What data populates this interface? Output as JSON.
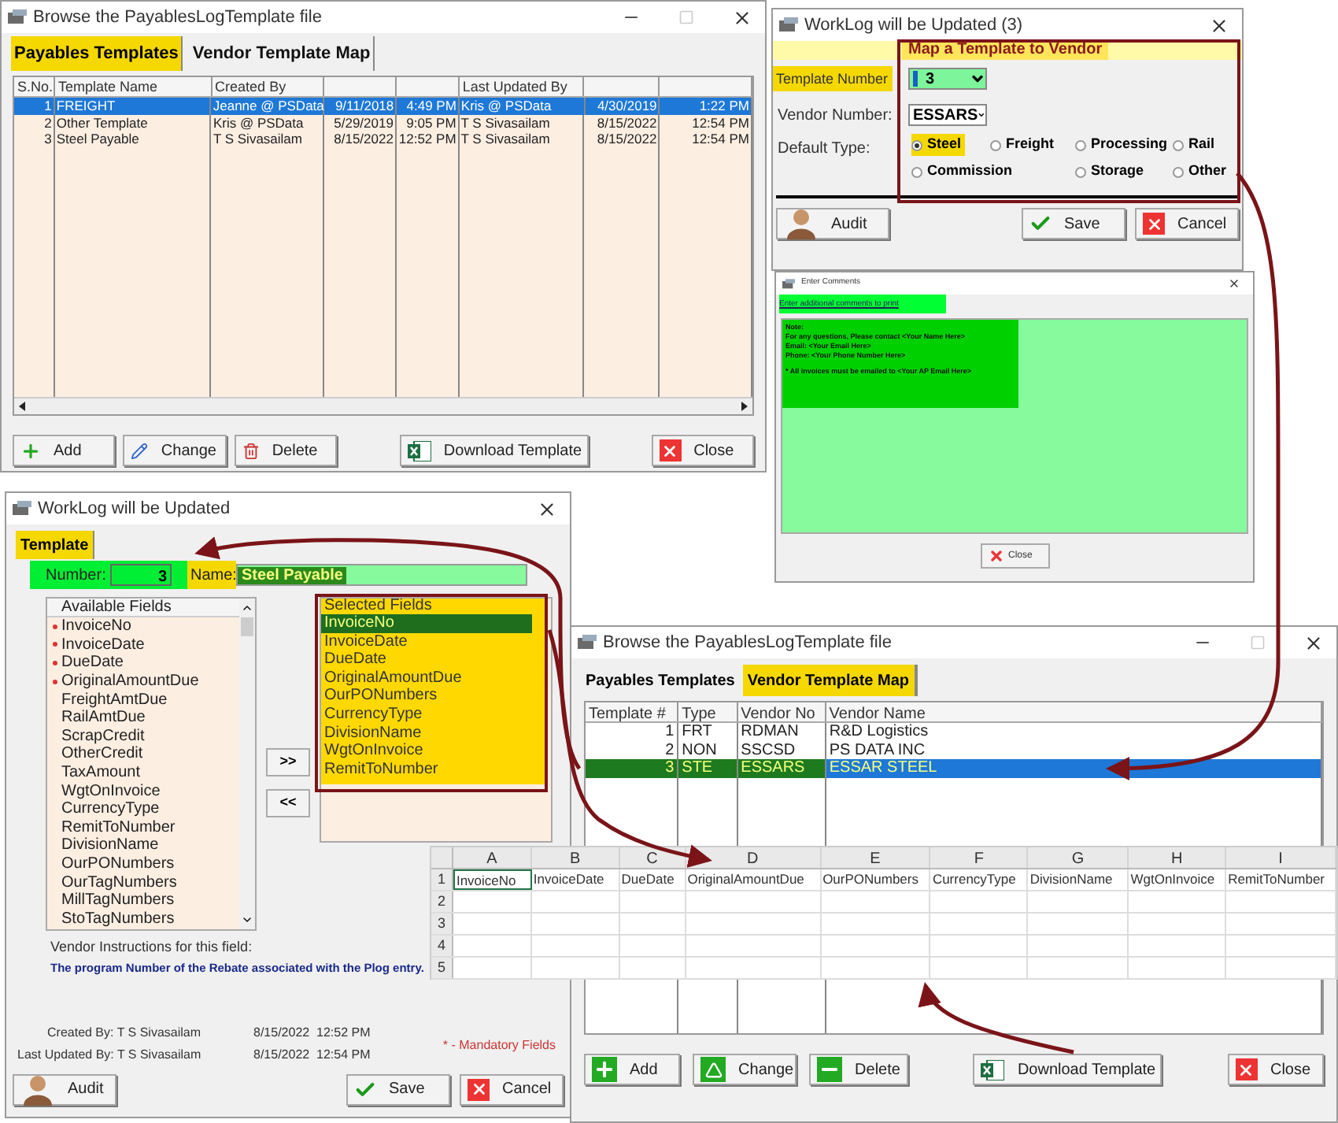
{
  "browse_templates_window": {
    "title": "Browse the PayablesLogTemplate file",
    "tabs": [
      {
        "label": "Payables Templates",
        "selected": true
      },
      {
        "label": "Vendor Template Map",
        "selected": false
      }
    ],
    "columns": [
      "S.No.",
      "Template Name",
      "Created By",
      "",
      "",
      "Last Updated By",
      "",
      ""
    ],
    "rows": [
      {
        "cells": [
          "1",
          "FREIGHT",
          "Jeanne @ PSData",
          "9/11/2018",
          "4:49 PM",
          "Kris @ PSData",
          "4/30/2019",
          "1:22 PM"
        ],
        "selected": true
      },
      {
        "cells": [
          "2",
          "Other Template",
          "Kris @ PSData",
          "5/29/2019",
          "9:05 PM",
          "T S Sivasailam",
          "8/15/2022",
          "12:54 PM"
        ],
        "selected": false
      },
      {
        "cells": [
          "3",
          "Steel Payable",
          "T S Sivasailam",
          "8/15/2022",
          "12:52 PM",
          "T S Sivasailam",
          "8/15/2022",
          "12:54 PM"
        ],
        "selected": false
      }
    ],
    "buttons": [
      {
        "label": "Add",
        "kind": "add"
      },
      {
        "label": "Change",
        "kind": "change"
      },
      {
        "label": "Delete",
        "kind": "delete"
      },
      {
        "label": "Download Template",
        "kind": "download"
      },
      {
        "label": "Close",
        "kind": "close"
      }
    ]
  },
  "map_vendor_window": {
    "title": "WorkLog will be Updated  (3)",
    "heading": "Map a Template to Vendor",
    "template_number": {
      "label": "Template Number",
      "value": "3"
    },
    "vendor_number": {
      "label": "Vendor Number:",
      "value": "ESSARS"
    },
    "default_type": {
      "label": "Default Type:",
      "options": [
        {
          "label": "Steel",
          "selected": true
        },
        {
          "label": "Freight",
          "selected": false
        },
        {
          "label": "Processing",
          "selected": false
        },
        {
          "label": "Rail",
          "selected": false
        },
        {
          "label": "Commission",
          "selected": false
        },
        {
          "label": "Storage",
          "selected": false
        },
        {
          "label": "Other",
          "selected": false
        }
      ]
    },
    "buttons": [
      {
        "label": "Audit",
        "kind": "audit"
      },
      {
        "label": "Save",
        "kind": "save"
      },
      {
        "label": "Cancel",
        "kind": "cancel"
      }
    ]
  },
  "comments_window": {
    "title": "Enter Comments",
    "link": "Enter additional comments to print",
    "paragraphs": [
      [
        "Note:",
        "For any questions, Please contact <Your Name Here>",
        "Email: <Your Email Here>",
        "Phone: <Your Phone Number Here>"
      ],
      [
        "* All invoices must be emailed to <Your AP Email Here>"
      ]
    ],
    "button": "Close"
  },
  "template_window": {
    "title": "WorkLog will be Updated",
    "tabs": [
      {
        "label": "Template",
        "selected": true
      }
    ],
    "number": {
      "label": "Number:",
      "value": "3"
    },
    "name": {
      "label": "Name:",
      "value": "Steel Payable"
    },
    "available_fields": {
      "header": "Available Fields",
      "items": [
        {
          "label": "InvoiceNo",
          "mandatory": true
        },
        {
          "label": "InvoiceDate",
          "mandatory": true
        },
        {
          "label": "DueDate",
          "mandatory": true
        },
        {
          "label": "OriginalAmountDue",
          "mandatory": true
        },
        {
          "label": "FreightAmtDue",
          "mandatory": false
        },
        {
          "label": "RailAmtDue",
          "mandatory": false
        },
        {
          "label": "ScrapCredit",
          "mandatory": false
        },
        {
          "label": "OtherCredit",
          "mandatory": false
        },
        {
          "label": "TaxAmount",
          "mandatory": false
        },
        {
          "label": "WgtOnInvoice",
          "mandatory": false
        },
        {
          "label": "CurrencyType",
          "mandatory": false
        },
        {
          "label": "RemitToNumber",
          "mandatory": false
        },
        {
          "label": "DivisionName",
          "mandatory": false
        },
        {
          "label": "OurPONumbers",
          "mandatory": false
        },
        {
          "label": "OurTagNumbers",
          "mandatory": false
        },
        {
          "label": "MillTagNumbers",
          "mandatory": false
        },
        {
          "label": "StoTagNumbers",
          "mandatory": false
        }
      ]
    },
    "move_buttons": [
      ">>",
      "<<"
    ],
    "selected_fields": {
      "header": "Selected Fields",
      "items": [
        {
          "label": "InvoiceNo",
          "selected": true
        },
        {
          "label": "InvoiceDate",
          "selected": false
        },
        {
          "label": "DueDate",
          "selected": false
        },
        {
          "label": "OriginalAmountDue",
          "selected": false
        },
        {
          "label": "OurPONumbers",
          "selected": false
        },
        {
          "label": "CurrencyType",
          "selected": false
        },
        {
          "label": "DivisionName",
          "selected": false
        },
        {
          "label": "WgtOnInvoice",
          "selected": false
        },
        {
          "label": "RemitToNumber",
          "selected": false
        }
      ]
    },
    "instructions_label": "Vendor Instructions for this field:",
    "instructions": "The program Number of the Rebate associated with the Plog entry.",
    "audit_rows": [
      {
        "label": "Created By: T S Sivasailam",
        "date": "8/15/2022",
        "time": "12:52 PM"
      },
      {
        "label": "Last Updated By: T S Sivasailam",
        "date": "8/15/2022",
        "time": "12:54 PM"
      }
    ],
    "mandatory_note": "* - Mandatory Fields",
    "buttons": [
      {
        "label": "Audit",
        "kind": "audit"
      },
      {
        "label": "Save",
        "kind": "save"
      },
      {
        "label": "Cancel",
        "kind": "cancel"
      }
    ]
  },
  "browse_map_window": {
    "title": "Browse the PayablesLogTemplate file",
    "tabs": [
      {
        "label": "Payables Templates",
        "selected": false
      },
      {
        "label": "Vendor Template Map",
        "selected": true
      }
    ],
    "columns": [
      "Template #",
      "Type",
      "Vendor No",
      "Vendor Name"
    ],
    "rows": [
      {
        "cells": [
          "1",
          "FRT",
          "RDMAN",
          "R&D Logistics"
        ],
        "selected": false
      },
      {
        "cells": [
          "2",
          "NON",
          "SSCSD",
          "PS DATA INC"
        ],
        "selected": false
      },
      {
        "cells": [
          "3",
          "STE",
          "ESSARS",
          "ESSAR STEEL"
        ],
        "selected": true
      }
    ],
    "buttons": [
      {
        "label": "Add",
        "kind": "add"
      },
      {
        "label": "Change",
        "kind": "change"
      },
      {
        "label": "Delete",
        "kind": "delete"
      },
      {
        "label": "Download Template",
        "kind": "download"
      },
      {
        "label": "Close",
        "kind": "close"
      }
    ]
  },
  "spreadsheet": {
    "columns": [
      "A",
      "B",
      "C",
      "D",
      "E",
      "F",
      "G",
      "H",
      "I"
    ],
    "rows": [
      "1",
      "2",
      "3",
      "4",
      "5"
    ],
    "header_cells": [
      "InvoiceNo",
      "InvoiceDate",
      "DueDate",
      "OriginalAmountDue",
      "OurPONumbers",
      "CurrencyType",
      "DivisionName",
      "WgtOnInvoice",
      "RemitToNumber"
    ]
  }
}
